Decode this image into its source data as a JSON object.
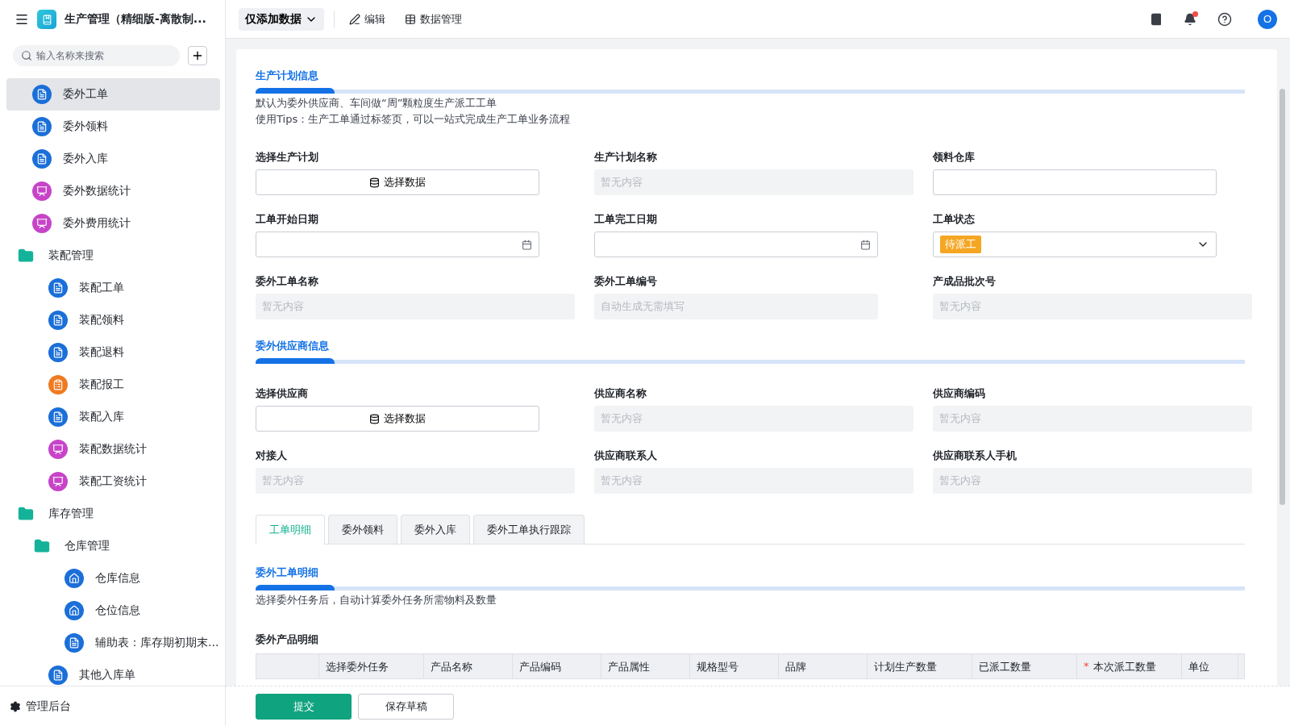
{
  "app": {
    "title": "生产管理（精细版-离散制..."
  },
  "sidebar": {
    "search": {
      "placeholder": "输入名称来搜索"
    },
    "items": [
      {
        "label": "委外工单",
        "kind": "doc",
        "selected": true
      },
      {
        "label": "委外领料",
        "kind": "doc",
        "selected": false
      },
      {
        "label": "委外入库",
        "kind": "doc",
        "selected": false
      },
      {
        "label": "委外数据统计",
        "kind": "chart",
        "selected": false
      },
      {
        "label": "委外费用统计",
        "kind": "chart",
        "selected": false
      },
      {
        "label": "装配管理",
        "kind": "folder",
        "selected": false,
        "children": [
          {
            "label": "装配工单",
            "kind": "doc",
            "selected": false
          },
          {
            "label": "装配领料",
            "kind": "doc",
            "selected": false
          },
          {
            "label": "装配退料",
            "kind": "doc",
            "selected": false
          },
          {
            "label": "装配报工",
            "kind": "report",
            "selected": false
          },
          {
            "label": "装配入库",
            "kind": "doc",
            "selected": false
          },
          {
            "label": "装配数据统计",
            "kind": "chart",
            "selected": false
          },
          {
            "label": "装配工资统计",
            "kind": "chart",
            "selected": false
          }
        ]
      },
      {
        "label": "库存管理",
        "kind": "folder",
        "selected": false,
        "children": [
          {
            "label": "仓库管理",
            "kind": "folder",
            "selected": false,
            "children": [
              {
                "label": "仓库信息",
                "kind": "home",
                "selected": false
              },
              {
                "label": "仓位信息",
                "kind": "home",
                "selected": false
              },
              {
                "label": "辅助表：库存期初期末...",
                "kind": "doc",
                "selected": false
              }
            ]
          },
          {
            "label": "其他入库单",
            "kind": "doc",
            "selected": false
          }
        ]
      }
    ],
    "footer": "管理后台"
  },
  "toolbar": {
    "mode": "仅添加数据",
    "actions": [
      {
        "label": "编辑",
        "kind": "edit"
      },
      {
        "label": "数据管理",
        "kind": "table"
      }
    ],
    "avatar": "O",
    "has_notification": true
  },
  "sections": [
    {
      "title": "生产计划信息",
      "notes": [
        "默认为委外供应商、车间做“周”颗粒度生产派工工单",
        "使用Tips：生产工单通过标签页，可以一站式完成生产工单业务流程"
      ],
      "fields": [
        {
          "label": "选择生产计划",
          "kind": "button",
          "value": "选择数据"
        },
        {
          "label": "生产计划名称",
          "kind": "readonly",
          "placeholder": "暂无内容"
        },
        {
          "label": "领料仓库",
          "kind": "text"
        },
        {
          "label": "工单开始日期",
          "kind": "date"
        },
        {
          "label": "工单完工日期",
          "kind": "date"
        },
        {
          "label": "工单状态",
          "kind": "select",
          "tag": "待派工",
          "color": "#f5a623"
        },
        {
          "label": "委外工单名称",
          "kind": "readonly",
          "placeholder": "暂无内容"
        },
        {
          "label": "委外工单编号",
          "kind": "readonly",
          "placeholder": "自动生成无需填写"
        },
        {
          "label": "产成品批次号",
          "kind": "readonly",
          "placeholder": "暂无内容"
        }
      ]
    },
    {
      "title": "委外供应商信息",
      "fields": [
        {
          "label": "选择供应商",
          "kind": "button",
          "value": "选择数据"
        },
        {
          "label": "供应商名称",
          "kind": "readonly",
          "placeholder": "暂无内容"
        },
        {
          "label": "供应商编码",
          "kind": "readonly",
          "placeholder": "暂无内容"
        },
        {
          "label": "对接人",
          "kind": "readonly",
          "placeholder": "暂无内容"
        },
        {
          "label": "供应商联系人",
          "kind": "readonly",
          "placeholder": "暂无内容"
        },
        {
          "label": "供应商联系人手机",
          "kind": "readonly",
          "placeholder": "暂无内容"
        }
      ]
    }
  ],
  "tabs": [
    {
      "label": "工单明细",
      "selected": true
    },
    {
      "label": "委外领料",
      "selected": false
    },
    {
      "label": "委外入库",
      "selected": false
    },
    {
      "label": "委外工单执行跟踪",
      "selected": false
    }
  ],
  "detail": {
    "title": "委外工单明细",
    "notes": [
      "选择委外任务后，自动计算委外任务所需物料及数量"
    ],
    "table_title": "委外产品明细",
    "columns": [
      {
        "kind": "blank"
      },
      {
        "kind": "text",
        "label": "选择委外任务"
      },
      {
        "kind": "text",
        "label": "产品名称"
      },
      {
        "kind": "text",
        "label": "产品编码"
      },
      {
        "kind": "text",
        "label": "产品属性"
      },
      {
        "kind": "text",
        "label": "规格型号"
      },
      {
        "kind": "text",
        "label": "品牌"
      },
      {
        "kind": "text",
        "label": "计划生产数量"
      },
      {
        "kind": "text",
        "label": "已派工数量"
      },
      {
        "kind": "text",
        "label": "本次派工数量",
        "mark": "*"
      },
      {
        "kind": "text",
        "label": "单位"
      }
    ]
  },
  "actions": [
    {
      "label": "提交",
      "kind": "primary"
    },
    {
      "label": "保存草稿",
      "kind": "secondary"
    }
  ]
}
